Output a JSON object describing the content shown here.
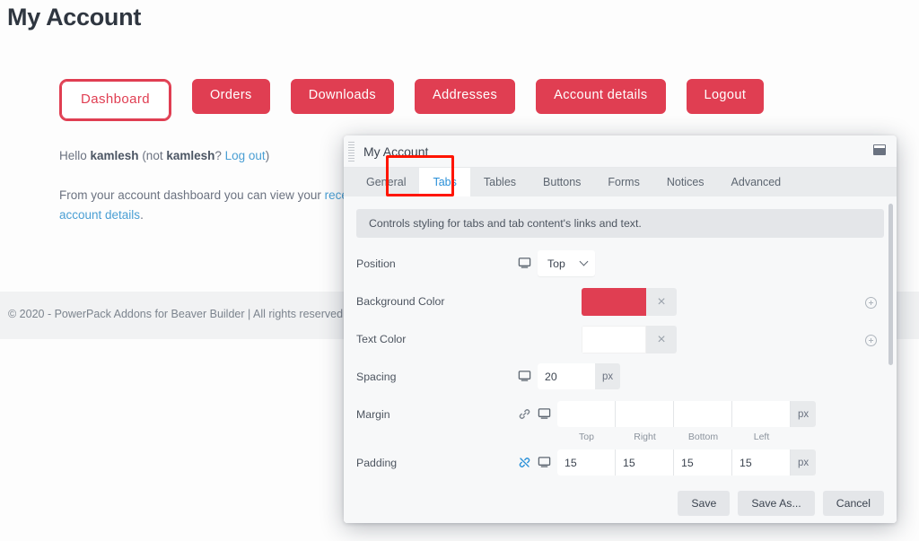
{
  "page": {
    "title": "My Account",
    "tabs": [
      {
        "label": "Dashboard",
        "active": true
      },
      {
        "label": "Orders",
        "active": false
      },
      {
        "label": "Downloads",
        "active": false
      },
      {
        "label": "Addresses",
        "active": false
      },
      {
        "label": "Account details",
        "active": false
      },
      {
        "label": "Logout",
        "active": false
      }
    ],
    "greeting": {
      "hello": "Hello ",
      "user": "kamlesh",
      "not_open": " (not ",
      "user2": "kamlesh",
      "question": "? ",
      "logout_link": "Log out",
      "close": ")"
    },
    "dashboard_text": {
      "part1": "From your account dashboard you can view your ",
      "link1": "recent",
      "link2": "account details",
      "end": "."
    },
    "footer": "© 2020 - PowerPack Addons for Beaver Builder | All rights reserved",
    "accent_color": "#e03e52",
    "link_color": "#4a9fd4"
  },
  "modal": {
    "title": "My Account",
    "maximize_icon": "maximize-icon",
    "drag_handle_icon": "drag-handle-icon",
    "tabs": [
      {
        "label": "General",
        "active": false
      },
      {
        "label": "Tabs",
        "active": true
      },
      {
        "label": "Tables",
        "active": false
      },
      {
        "label": "Buttons",
        "active": false
      },
      {
        "label": "Forms",
        "active": false
      },
      {
        "label": "Notices",
        "active": false
      },
      {
        "label": "Advanced",
        "active": false
      }
    ],
    "highlight_color": "#ff1500",
    "description": "Controls styling for tabs and tab content's links and text.",
    "fields": {
      "position": {
        "label": "Position",
        "value": "Top",
        "responsive_icon": "desktop-icon"
      },
      "background_color": {
        "label": "Background Color",
        "value": "#e03e52",
        "clear_icon": "×",
        "add_icon": "plus-circle-icon"
      },
      "text_color": {
        "label": "Text Color",
        "value": "#ffffff",
        "clear_icon": "×",
        "add_icon": "plus-circle-icon"
      },
      "spacing": {
        "label": "Spacing",
        "value": "20",
        "unit": "px",
        "responsive_icon": "desktop-icon"
      },
      "margin": {
        "label": "Margin",
        "unit": "px",
        "link_icon": "link-icon",
        "responsive_icon": "desktop-icon",
        "values": {
          "top": "",
          "right": "",
          "bottom": "",
          "left": ""
        },
        "sublabels": {
          "top": "Top",
          "right": "Right",
          "bottom": "Bottom",
          "left": "Left"
        }
      },
      "padding": {
        "label": "Padding",
        "unit": "px",
        "link_icon": "link-broken-icon",
        "responsive_icon": "desktop-icon",
        "values": {
          "top": "15",
          "right": "15",
          "bottom": "15",
          "left": "15"
        }
      }
    },
    "footer_buttons": {
      "save": "Save",
      "save_as": "Save As...",
      "cancel": "Cancel"
    }
  }
}
